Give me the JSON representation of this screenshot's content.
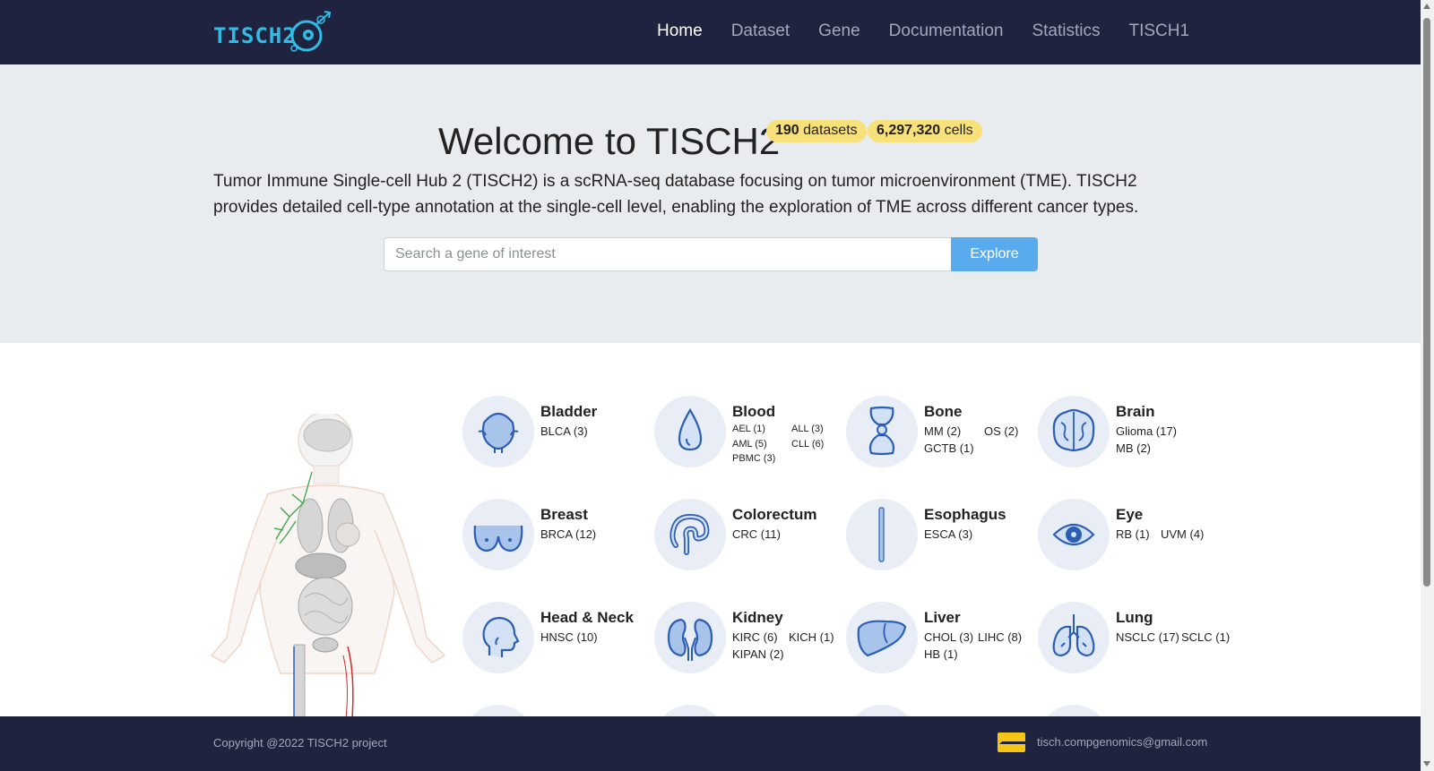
{
  "logo": {
    "text": "TISCH2"
  },
  "nav": {
    "items": [
      "Home",
      "Dataset",
      "Gene",
      "Documentation",
      "Statistics",
      "TISCH1"
    ],
    "active": "Home"
  },
  "hero": {
    "title": "Welcome to TISCH2",
    "badge_datasets_count": "190",
    "badge_datasets_label": "datasets",
    "badge_cells_count": "6,297,320",
    "badge_cells_label": "cells",
    "description": "Tumor Immune Single-cell Hub 2 (TISCH2) is a scRNA-seq database focusing on tumor microenvironment (TME). TISCH2 provides detailed cell-type annotation at the single-cell level, enabling the exploration of TME across different cancer types.",
    "search_placeholder": "Search a gene of interest",
    "explore_label": "Explore"
  },
  "cancers": [
    {
      "name": "Bladder",
      "subtypes": [
        "BLCA (3)"
      ]
    },
    {
      "name": "Blood",
      "subtypes": [
        "AEL (1)",
        "ALL (3)",
        "AML (5)",
        "CLL (6)",
        "PBMC (3)"
      ]
    },
    {
      "name": "Bone",
      "subtypes": [
        "MM (2)",
        "OS (2)",
        "GCTB (1)"
      ]
    },
    {
      "name": "Brain",
      "subtypes": [
        "Glioma (17)",
        "MB (2)"
      ]
    },
    {
      "name": "Breast",
      "subtypes": [
        "BRCA (12)"
      ]
    },
    {
      "name": "Colorectum",
      "subtypes": [
        "CRC (11)"
      ]
    },
    {
      "name": "Esophagus",
      "subtypes": [
        "ESCA (3)"
      ]
    },
    {
      "name": "Eye",
      "subtypes": [
        "RB (1)",
        "UVM (4)"
      ]
    },
    {
      "name": "Head & Neck",
      "subtypes": [
        "HNSC (10)"
      ]
    },
    {
      "name": "Kidney",
      "subtypes": [
        "KIRC (6)",
        "KICH (1)",
        "KIPAN (2)"
      ]
    },
    {
      "name": "Liver",
      "subtypes": [
        "CHOL (3)",
        "LIHC (8)",
        "HB (1)"
      ]
    },
    {
      "name": "Lung",
      "subtypes": [
        "NSCLC (17)",
        "SCLC (1)"
      ]
    }
  ],
  "footer": {
    "copyright": "Copyright @2022 TISCH2 project",
    "email": "tisch.compgenomics@gmail.com"
  },
  "colors": {
    "navbar_bg": "#1f2340",
    "hero_bg": "#e9ecef",
    "badge_bg": "#f8e07a",
    "button_bg": "#5aabee",
    "logo_blue": "#2fbde6",
    "organ_blue": "#4a7ec9"
  }
}
